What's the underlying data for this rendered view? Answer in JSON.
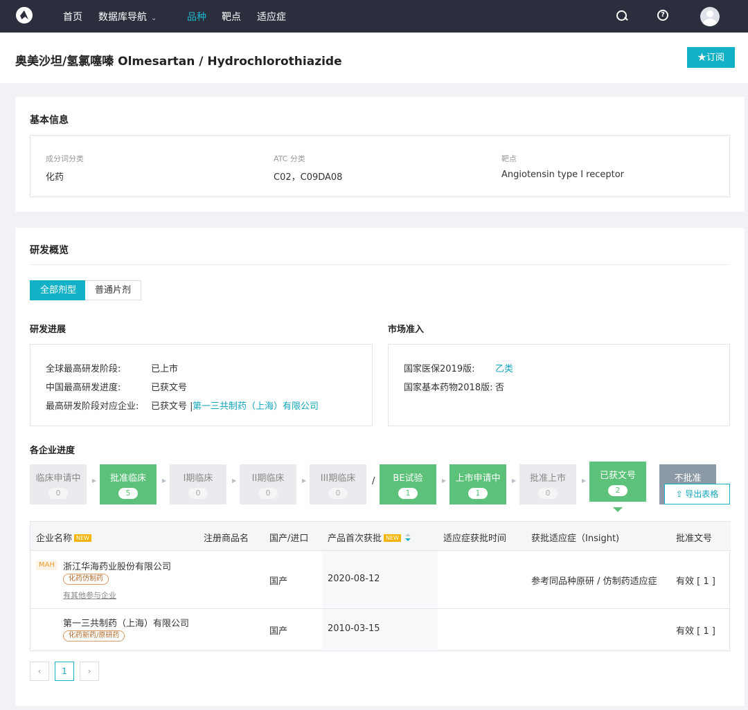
{
  "nav": {
    "items": [
      "首页",
      "数据库导航",
      "品种",
      "靶点",
      "适应症"
    ],
    "active_index": 2
  },
  "header": {
    "title": "奥美沙坦/氢氯噻嗪 Olmesartan / Hydrochlorothiazide",
    "subscribe": "★订阅"
  },
  "basic": {
    "title": "基本信息",
    "fields": [
      {
        "label": "成分词分类",
        "value": "化药"
      },
      {
        "label": "ATC 分类",
        "value": "C02，C09DA08"
      },
      {
        "label": "靶点",
        "value": "Angiotensin type I receptor"
      }
    ]
  },
  "rd": {
    "title": "研发概览",
    "tabs": [
      "全部剂型",
      "普通片剂"
    ],
    "progress_title": "研发进展",
    "progress": {
      "global_label": "全球最高研发阶段:",
      "global_value": "已上市",
      "china_label": "中国最高研发进度:",
      "china_value": "已获文号",
      "company_label": "最高研发阶段对应企业:",
      "company_status": "已获文号 |",
      "company_link": "第一三共制药（上海）有限公司"
    },
    "market_title": "市场准入",
    "market": {
      "insurance_label": "国家医保2019版:",
      "insurance_value": "乙类",
      "essential_label": "国家基本药物2018版:",
      "essential_value": "否"
    },
    "enterprise_title": "各企业进度",
    "stages": [
      {
        "label": "临床申请中",
        "count": "0",
        "state": "default"
      },
      {
        "label": "批准临床",
        "count": "5",
        "state": "green"
      },
      {
        "label": "I期临床",
        "count": "0",
        "state": "default"
      },
      {
        "label": "II期临床",
        "count": "0",
        "state": "default"
      },
      {
        "label": "III期临床",
        "count": "0",
        "state": "default"
      },
      {
        "label": "BE试验",
        "count": "1",
        "state": "green"
      },
      {
        "label": "上市申请中",
        "count": "1",
        "state": "green"
      },
      {
        "label": "批准上市",
        "count": "0",
        "state": "default"
      },
      {
        "label": "已获文号",
        "count": "2",
        "state": "green"
      },
      {
        "label": "不批准",
        "count": "",
        "state": "grey"
      }
    ],
    "slash": "/",
    "export": "导出表格"
  },
  "table": {
    "headers": [
      "企业名称",
      "注册商品名",
      "国产/进口",
      "产品首次获批",
      "适应症获批时间",
      "获批适应症（Insight)",
      "批准文号"
    ],
    "new_badge": "NEW",
    "rows": [
      {
        "mah": "MAH",
        "company": "浙江华海药业股份有限公司",
        "tag": "化药仿制药",
        "other": "有其他参与企业",
        "origin": "国产",
        "first_approval": "2020-08-12",
        "indication": "参考同品种原研 / 仿制药适应症",
        "approval": "有效 [ 1 ]"
      },
      {
        "company": "第一三共制药（上海）有限公司",
        "tag": "化药新药/原研药",
        "origin": "国产",
        "first_approval": "2010-03-15",
        "indication": "",
        "approval": "有效 [ 1 ]"
      }
    ]
  },
  "pagination": {
    "prev": "‹",
    "current": "1",
    "next": "›"
  }
}
